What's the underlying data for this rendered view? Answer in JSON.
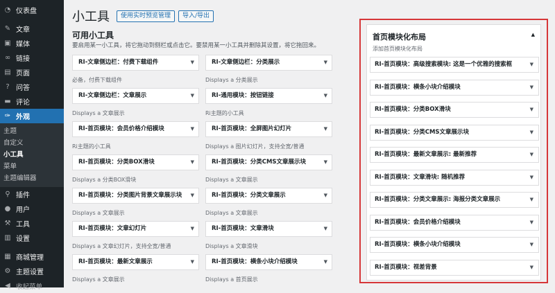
{
  "sidebar": {
    "top": [
      {
        "label": "仪表盘",
        "icon": "dashboard-icon",
        "glyph": "◔"
      }
    ],
    "items": [
      {
        "label": "文章",
        "icon": "pin-icon",
        "glyph": "✎"
      },
      {
        "label": "媒体",
        "icon": "media-icon",
        "glyph": "▣"
      },
      {
        "label": "链接",
        "icon": "link-icon",
        "glyph": "∞"
      },
      {
        "label": "页面",
        "icon": "page-icon",
        "glyph": "▤"
      },
      {
        "label": "问答",
        "icon": "question-icon",
        "glyph": "?"
      },
      {
        "label": "评论",
        "icon": "comment-icon",
        "glyph": "▬"
      }
    ],
    "current": {
      "label": "外观",
      "icon": "appearance-brush-icon",
      "glyph": "✑"
    },
    "submenu": [
      "主题",
      "自定义",
      "小工具",
      "菜单",
      "主题编辑器"
    ],
    "submenu_current": "小工具",
    "items2": [
      {
        "label": "插件",
        "icon": "plugin-icon",
        "glyph": "⚲"
      },
      {
        "label": "用户",
        "icon": "user-icon",
        "glyph": "●"
      },
      {
        "label": "工具",
        "icon": "wrench-icon",
        "glyph": "⚒"
      },
      {
        "label": "设置",
        "icon": "settings-icon",
        "glyph": "▥"
      }
    ],
    "items3": [
      {
        "label": "商城管理",
        "icon": "shop-icon",
        "glyph": "▦"
      },
      {
        "label": "主题设置",
        "icon": "gear-icon",
        "glyph": "⚙"
      }
    ],
    "collapse": {
      "label": "收起菜单",
      "icon": "collapse-icon",
      "glyph": "◀"
    }
  },
  "header": {
    "title": "小工具",
    "btn_preview": "使用实时预览管理",
    "btn_import": "导入/导出"
  },
  "available": {
    "title": "可用小工具",
    "desc": "要启用某一小工具，将它拖动到侧栏或点击它。要禁用某一小工具并删除其设置，将它拖回来。",
    "left": [
      {
        "label": "RI-文章侧边栏：付费下载组件",
        "desc": "必备，付费下载组件"
      },
      {
        "label": "RI-文章侧边栏：文章展示",
        "desc": "Displays a 文章展示"
      },
      {
        "label": "RI-首页模块：会员价格介绍模块",
        "desc": "Ri主题的小工具"
      },
      {
        "label": "RI-首页模块：分类BOX滑块",
        "desc": "Displays a 分类BOX滑块"
      },
      {
        "label": "RI-首页模块：分类图片背景文章展示块",
        "desc": "Displays a 文章展示"
      },
      {
        "label": "RI-首页模块：文章幻灯片",
        "desc": "Displays a 文章幻灯片，支持全宽/普通"
      },
      {
        "label": "RI-首页模块：最新文章展示",
        "desc": "Displays a 文章展示"
      }
    ],
    "right": [
      {
        "label": "RI-文章侧边栏：分类展示",
        "desc": "Displays a 分类展示"
      },
      {
        "label": "RI-通用模块：按钮链接",
        "desc": "Ri主题的小工具"
      },
      {
        "label": "RI-首页模块：全屏图片幻灯片",
        "desc": "Displays a 图片幻灯片，支持全宽/普通"
      },
      {
        "label": "RI-首页模块：分类CMS文章展示块",
        "desc": "Displays a 文章展示"
      },
      {
        "label": "RI-首页模块：分类文章展示",
        "desc": "Displays a 文章展示"
      },
      {
        "label": "RI-首页模块：文章滑块",
        "desc": "Displays a 文章滑块"
      },
      {
        "label": "RI-首页模块：横条小块介绍模块",
        "desc": "Displays a 首页展示"
      }
    ]
  },
  "panel": {
    "title": "首页模块化布局",
    "desc": "添加首页模块化布局",
    "widgets": [
      "RI-首页模块：高级搜索模块: 这是一个优雅的搜索框",
      "RI-首页模块：横条小块介绍模块",
      "RI-首页模块：分类BOX滑块",
      "RI-首页模块：分类CMS文章展示块",
      "RI-首页模块：最新文章展示: 最新推荐",
      "RI-首页模块：文章滑块: 随机推荐",
      "RI-首页模块：分类文章展示: 海报分类文章展示",
      "RI-首页模块：会员价格介绍模块",
      "RI-首页模块：横条小块介绍模块",
      "RI-首页模块：视差背景"
    ]
  },
  "colors": {
    "accent": "#2271b1",
    "sidebar_bg": "#1d2327",
    "highlight_border": "#d63638"
  }
}
